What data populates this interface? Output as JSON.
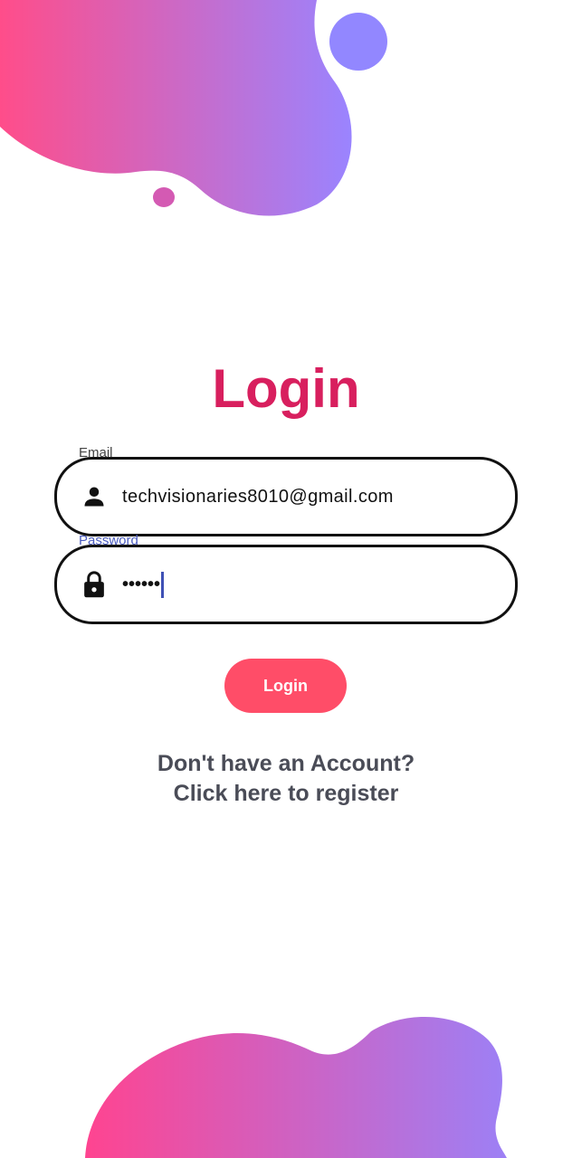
{
  "page": {
    "title": "Login"
  },
  "email_field": {
    "label": "Email",
    "value": "techvisionaries8010@gmail.com",
    "icon": "person-icon"
  },
  "password_field": {
    "label": "Password",
    "value": "••••••",
    "icon": "lock-icon"
  },
  "login_button": {
    "label": "Login"
  },
  "register_link": {
    "line1": "Don't have an Account?",
    "line2": "Click here to register"
  },
  "colors": {
    "title": "#d81f5e",
    "button": "#ff4d68",
    "gradient_start": "#ff4d8a",
    "gradient_end": "#9b7dff",
    "focus_label": "#4a5bbf"
  }
}
